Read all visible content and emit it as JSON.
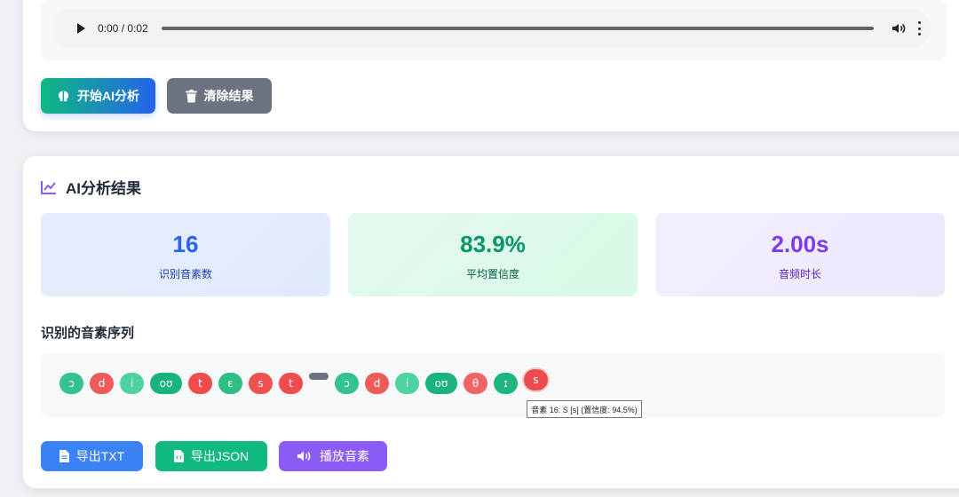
{
  "audio": {
    "time": "0:00 / 0:02"
  },
  "actions": {
    "analyze_label": "开始AI分析",
    "clear_label": "清除结果"
  },
  "results": {
    "title": "AI分析结果",
    "stats": [
      {
        "value": "16",
        "label": "识别音素数"
      },
      {
        "value": "83.9%",
        "label": "平均置信度"
      },
      {
        "value": "2.00s",
        "label": "音频时长"
      }
    ],
    "sequence_title": "识别的音素序列",
    "phonemes": [
      {
        "symbol": "ɔ",
        "color": "#34c38f"
      },
      {
        "symbol": "d",
        "color": "#ef5a5a"
      },
      {
        "symbol": "i",
        "color": "#4fd1a0"
      },
      {
        "symbol": "oʊ",
        "color": "#18b47b"
      },
      {
        "symbol": "t",
        "color": "#ef4d4d"
      },
      {
        "symbol": "ɛ",
        "color": "#2fbf85"
      },
      {
        "symbol": "s",
        "color": "#ef5050"
      },
      {
        "symbol": "t",
        "color": "#ef4d4d"
      },
      {
        "symbol": "",
        "color": "#6b7280"
      },
      {
        "symbol": "ɔ",
        "color": "#34c38f"
      },
      {
        "symbol": "d",
        "color": "#ef5a5a"
      },
      {
        "symbol": "i",
        "color": "#4fd1a0"
      },
      {
        "symbol": "oʊ",
        "color": "#18b47b"
      },
      {
        "symbol": "θ",
        "color": "#f06464"
      },
      {
        "symbol": "ɪ",
        "color": "#1fb67e"
      },
      {
        "symbol": "s",
        "color": "#ee4c4c"
      }
    ],
    "tooltip": "音素 16: S [s] (置信度: 94.5%)",
    "export_txt": "导出TXT",
    "export_json": "导出JSON",
    "play_phonemes": "播放音素"
  }
}
